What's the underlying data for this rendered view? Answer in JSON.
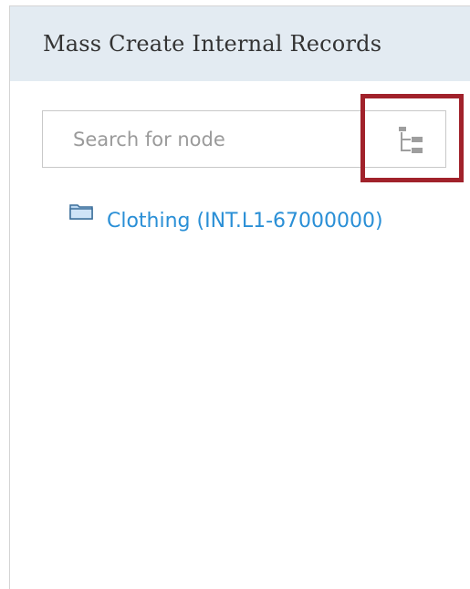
{
  "panel": {
    "title": "Mass Create Internal Records"
  },
  "search": {
    "placeholder": "Search for node",
    "value": ""
  },
  "tree_toggle": {
    "icon": "tree-view-icon",
    "highlight_color": "#a1222b"
  },
  "tree": {
    "nodes": [
      {
        "label": "Clothing (INT.L1-67000000)",
        "icon": "folder-icon"
      }
    ]
  },
  "colors": {
    "header_bg": "#e3ebf2",
    "link": "#2a8fd6",
    "highlight": "#a1222b"
  }
}
